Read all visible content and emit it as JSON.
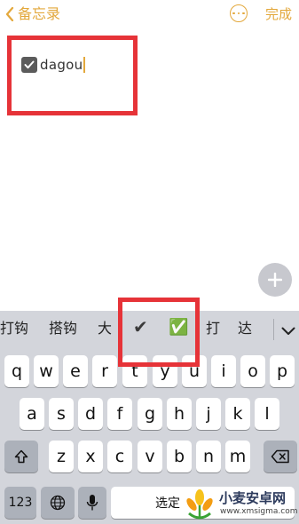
{
  "nav": {
    "back_label": "备忘录",
    "done_label": "完成"
  },
  "note": {
    "text": "dagou"
  },
  "keyboard": {
    "candidates": [
      "打钩",
      "搭钩",
      "大",
      "✔",
      "✅",
      "打",
      "达"
    ],
    "row1": [
      "q",
      "w",
      "e",
      "r",
      "t",
      "y",
      "u",
      "i",
      "o",
      "p"
    ],
    "row2": [
      "a",
      "s",
      "d",
      "f",
      "g",
      "h",
      "j",
      "k",
      "l"
    ],
    "row3": [
      "z",
      "x",
      "c",
      "v",
      "b",
      "n",
      "m"
    ],
    "numbers_label": "123",
    "space_label": "选定"
  },
  "watermark": {
    "text": "小麦安卓网",
    "url": "www.xmsigma.com"
  },
  "colors": {
    "accent": "#e3a83c",
    "annotation": "#e63338"
  }
}
